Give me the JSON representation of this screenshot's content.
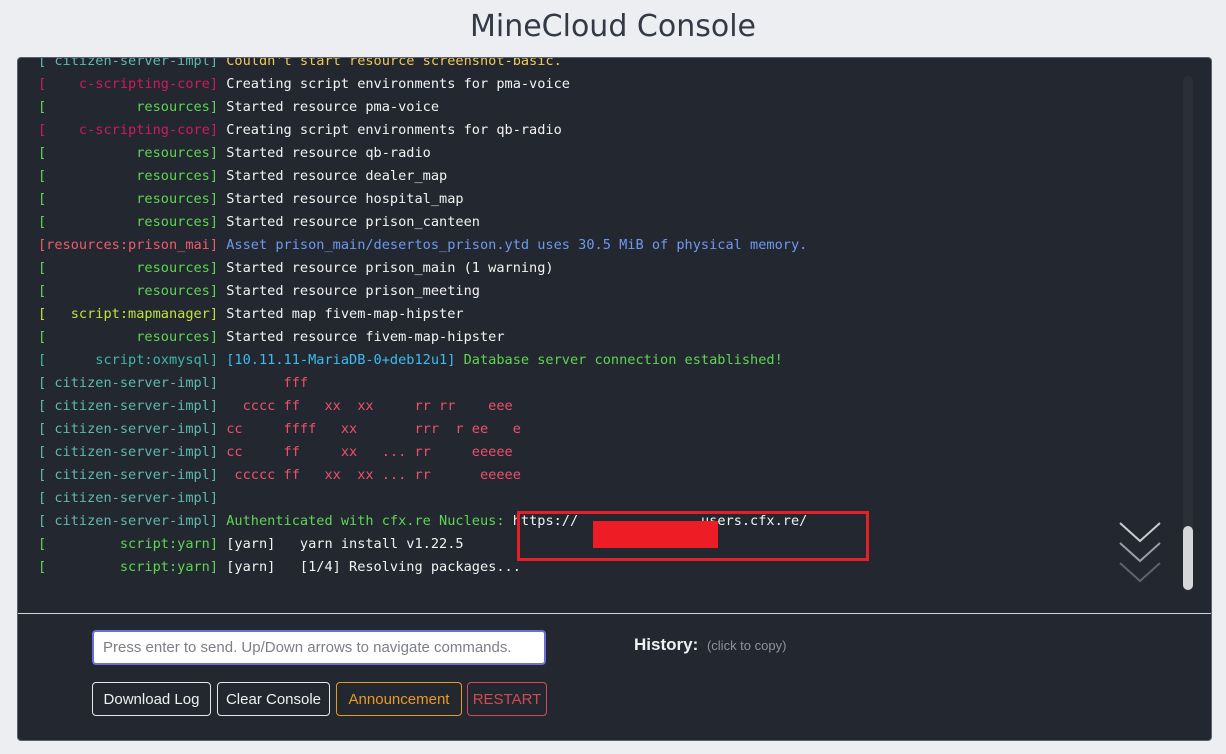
{
  "title": "MineCloud Console",
  "log_lines": [
    {
      "tag": "[ citizen-server-impl]",
      "tag_color": "#5fb8ad",
      "msg": " Couldn't start resource screenshot-basic.",
      "msg_color": "#f0c95a"
    },
    {
      "tag": "[    c-scripting-core]",
      "tag_color": "#d0195e",
      "msg": " Creating script environments for pma-voice",
      "msg_color": "#f2f2f2"
    },
    {
      "tag": "[           resources]",
      "tag_color": "#5ed552",
      "msg": " Started resource pma-voice",
      "msg_color": "#f2f2f2"
    },
    {
      "tag": "[    c-scripting-core]",
      "tag_color": "#d0195e",
      "msg": " Creating script environments for qb-radio",
      "msg_color": "#f2f2f2"
    },
    {
      "tag": "[           resources]",
      "tag_color": "#5ed552",
      "msg": " Started resource qb-radio",
      "msg_color": "#f2f2f2"
    },
    {
      "tag": "[           resources]",
      "tag_color": "#5ed552",
      "msg": " Started resource dealer_map",
      "msg_color": "#f2f2f2"
    },
    {
      "tag": "[           resources]",
      "tag_color": "#5ed552",
      "msg": " Started resource hospital_map",
      "msg_color": "#f2f2f2"
    },
    {
      "tag": "[           resources]",
      "tag_color": "#5ed552",
      "msg": " Started resource prison_canteen",
      "msg_color": "#f2f2f2"
    },
    {
      "tag": "[resources:prison_mai]",
      "tag_color": "#ef5b6d",
      "msg": " Asset prison_main/desertos_prison.ytd uses 30.5 MiB of physical memory.",
      "msg_color": "#6f98ee"
    },
    {
      "tag": "[           resources]",
      "tag_color": "#5ed552",
      "msg": " Started resource prison_main (1 warning)",
      "msg_color": "#f2f2f2"
    },
    {
      "tag": "[           resources]",
      "tag_color": "#5ed552",
      "msg": " Started resource prison_meeting",
      "msg_color": "#f2f2f2"
    },
    {
      "tag": "[   script:mapmanager]",
      "tag_color": "#bde639",
      "msg": " Started map fivem-map-hipster",
      "msg_color": "#f2f2f2"
    },
    {
      "tag": "[           resources]",
      "tag_color": "#5ed552",
      "msg": " Started resource fivem-map-hipster",
      "msg_color": "#f2f2f2"
    },
    {
      "tag": "[      script:oxmysql]",
      "tag_color": "#3fb6a8",
      "msg_parts": [
        {
          "text": " [10.11.11-MariaDB-0+deb12u1]",
          "color": "#3dbcf0"
        },
        {
          "text": " Database server connection established!",
          "color": "#5ed552"
        }
      ]
    },
    {
      "tag": "[ citizen-server-impl]",
      "tag_color": "#5fb8ad",
      "msg": "        fff",
      "msg_color": "#ef4f6a"
    },
    {
      "tag": "[ citizen-server-impl]",
      "tag_color": "#5fb8ad",
      "msg": "   cccc ff   xx  xx     rr rr    eee",
      "msg_color": "#ef4f6a"
    },
    {
      "tag": "[ citizen-server-impl]",
      "tag_color": "#5fb8ad",
      "msg": " cc     ffff   xx       rrr  r ee   e",
      "msg_color": "#ef4f6a"
    },
    {
      "tag": "[ citizen-server-impl]",
      "tag_color": "#5fb8ad",
      "msg": " cc     ff     xx   ... rr     eeeee",
      "msg_color": "#ef4f6a"
    },
    {
      "tag": "[ citizen-server-impl]",
      "tag_color": "#5fb8ad",
      "msg": "  ccccc ff   xx  xx ... rr      eeeee",
      "msg_color": "#ef4f6a"
    },
    {
      "tag": "[ citizen-server-impl]",
      "tag_color": "#5fb8ad",
      "msg": "",
      "msg_color": "#f2f2f2"
    },
    {
      "tag": "[ citizen-server-impl]",
      "tag_color": "#5fb8ad",
      "msg_parts": [
        {
          "text": " Authenticated with cfx.re Nucleus: ",
          "color": "#5ed552"
        },
        {
          "text": "https://",
          "color": "#f2f2f2"
        },
        {
          "text": "               ",
          "color": "#f2f2f2"
        },
        {
          "text": "users.cfx.re/",
          "color": "#f2f2f2"
        }
      ]
    },
    {
      "tag": "[         script:yarn]",
      "tag_color": "#5ed552",
      "msg": " [yarn]   yarn install v1.22.5",
      "msg_color": "#f2f2f2"
    },
    {
      "tag": "[         script:yarn]",
      "tag_color": "#5ed552",
      "msg": " [yarn]   [1/4] Resolving packages...",
      "msg_color": "#f2f2f2"
    }
  ],
  "input": {
    "placeholder": "Press enter to send. Up/Down arrows to navigate commands.",
    "value": ""
  },
  "history": {
    "label": "History:",
    "hint": "(click to copy)"
  },
  "buttons": {
    "download_log": "Download Log",
    "clear_console": "Clear Console",
    "announcement": "Announcement",
    "restart": "RESTART"
  },
  "icons": {
    "scroll_down": "chevron-down-triple-icon"
  },
  "colors": {
    "console_bg": "#232830",
    "page_bg": "#eceef1",
    "announcement": "#e79a22",
    "restart": "#d14a55",
    "highlight": "#e22025"
  }
}
